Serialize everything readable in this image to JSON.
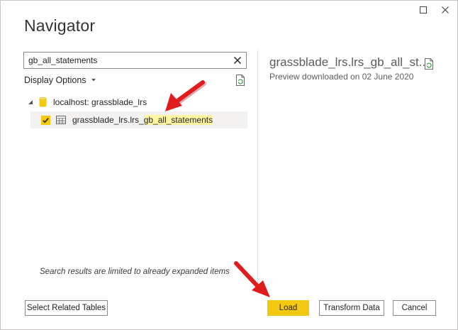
{
  "window": {
    "title": "Navigator",
    "controls": [
      "maximize-icon",
      "close-icon"
    ]
  },
  "search": {
    "value": "gb_all_statements",
    "clear_icon": "close-icon"
  },
  "display_options": {
    "label": "Display Options",
    "icon": "caret-down-icon"
  },
  "tree": {
    "server": {
      "label": "localhost: grassblade_lrs",
      "expand_icon": "expanded-triangle-icon",
      "icon": "database-icon"
    },
    "items": [
      {
        "label_prefix": "grassblade_lrs.lrs_",
        "label_match": "gb_all_statements",
        "checked": true,
        "icon": "table-icon"
      }
    ]
  },
  "preview": {
    "title": "grassblade_lrs.lrs_gb_all_st...",
    "subtitle": "Preview downloaded on 02 June 2020",
    "refresh_icon": "refresh-document-icon"
  },
  "search_note": "Search results are limited to already expanded items",
  "buttons": {
    "select_related": "Select Related Tables",
    "load": "Load",
    "transform": "Transform Data",
    "cancel": "Cancel"
  },
  "colors": {
    "accent": "#F2C811",
    "highlight": "#FFF5A0",
    "arrow": "#E01B1B",
    "selected_row": "#F3F2F1"
  }
}
